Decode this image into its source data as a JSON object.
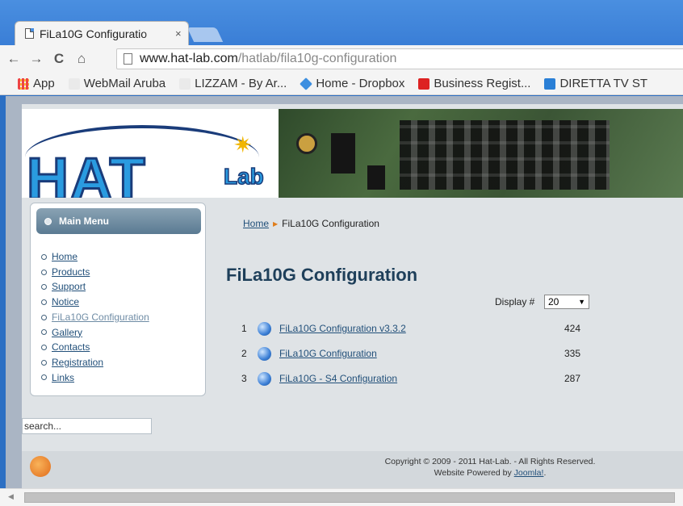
{
  "browser": {
    "tab_title": "FiLa10G Configuratio",
    "tab_close": "×",
    "url_host": "www.hat-lab.com",
    "url_path": "/hatlab/fila10g-configuration",
    "nav": {
      "back": "←",
      "forward": "→",
      "reload": "C",
      "home": "⌂"
    },
    "bookmarks": [
      {
        "label": "App",
        "icon": "apps-grid-icon",
        "color": "#e44"
      },
      {
        "label": "WebMail Aruba",
        "icon": "mail-icon",
        "color": "#eee"
      },
      {
        "label": "LIZZAM - By Ar...",
        "icon": "leaf-icon",
        "color": "#eee"
      },
      {
        "label": "Home - Dropbox",
        "icon": "dropbox-icon",
        "color": "#3d8fe0"
      },
      {
        "label": "Business Regist...",
        "icon": "s-logo-icon",
        "color": "#d22"
      },
      {
        "label": "DIRETTA TV ST",
        "icon": "g-logo-icon",
        "color": "#2a7fd6"
      }
    ]
  },
  "site": {
    "logo_text": "HAT",
    "logo_sub": "Lab",
    "menu_title": "Main Menu",
    "menu_items": [
      {
        "label": "Home",
        "current": false
      },
      {
        "label": "Products",
        "current": false
      },
      {
        "label": "Support",
        "current": false
      },
      {
        "label": "Notice",
        "current": false
      },
      {
        "label": "FiLa10G Configuration",
        "current": true
      },
      {
        "label": "Gallery",
        "current": false
      },
      {
        "label": "Contacts",
        "current": false
      },
      {
        "label": "Registration",
        "current": false
      },
      {
        "label": "Links",
        "current": false
      }
    ],
    "search_value": "search...",
    "breadcrumb": {
      "home": "Home",
      "current": "FiLa10G Configuration"
    },
    "page_title": "FiLa10G Configuration",
    "display_label": "Display #",
    "display_value": "20",
    "documents": [
      {
        "num": "1",
        "title": "FiLa10G Configuration v3.3.2",
        "hits": "424"
      },
      {
        "num": "2",
        "title": "FiLa10G Configuration",
        "hits": "335"
      },
      {
        "num": "3",
        "title": "FiLa10G - S4 Configuration",
        "hits": "287"
      }
    ],
    "footer": {
      "copyright": "Copyright © 2009 - 2011 Hat-Lab. - All Rights Reserved.",
      "powered_prefix": "Website Powered by ",
      "powered_link": "Joomla!",
      "powered_suffix": "."
    }
  }
}
